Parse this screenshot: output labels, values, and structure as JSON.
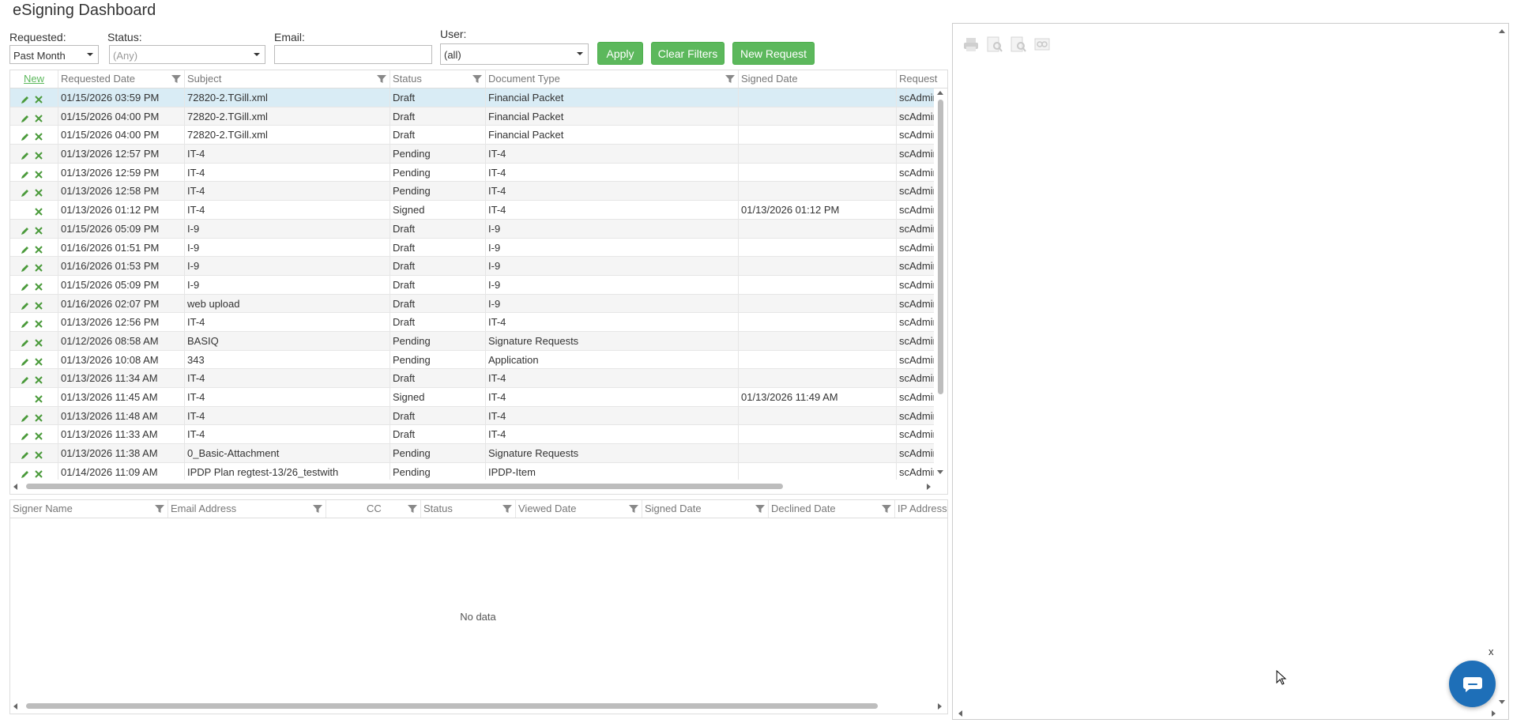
{
  "page": {
    "title": "eSigning Dashboard"
  },
  "filters": {
    "requested_label": "Requested:",
    "requested_value": "Past Month",
    "status_label": "Status:",
    "status_placeholder": "(Any)",
    "email_label": "Email:",
    "email_value": "",
    "user_label": "User:",
    "user_value": "(all)",
    "apply_label": "Apply",
    "clear_label": "Clear Filters",
    "new_request_label": "New Request"
  },
  "requests_grid": {
    "columns": {
      "new": "New",
      "requested_date": "Requested Date",
      "subject": "Subject",
      "status": "Status",
      "document_type": "Document Type",
      "signed_date": "Signed Date",
      "requested_by": "Request"
    },
    "rows": [
      {
        "edit": true,
        "requested": "01/15/2026 03:59 PM",
        "subject": "72820-2.TGill.xml",
        "status": "Draft",
        "doc_type": "Financial Packet",
        "signed": "",
        "by": "scAdmin"
      },
      {
        "edit": true,
        "requested": "01/15/2026 04:00 PM",
        "subject": "72820-2.TGill.xml",
        "status": "Draft",
        "doc_type": "Financial Packet",
        "signed": "",
        "by": "scAdmin"
      },
      {
        "edit": true,
        "requested": "01/15/2026 04:00 PM",
        "subject": "72820-2.TGill.xml",
        "status": "Draft",
        "doc_type": "Financial Packet",
        "signed": "",
        "by": "scAdmin"
      },
      {
        "edit": true,
        "requested": "01/13/2026 12:57 PM",
        "subject": "IT-4",
        "status": "Pending",
        "doc_type": "IT-4",
        "signed": "",
        "by": "scAdmin"
      },
      {
        "edit": true,
        "requested": "01/13/2026 12:59 PM",
        "subject": "IT-4",
        "status": "Pending",
        "doc_type": "IT-4",
        "signed": "",
        "by": "scAdmin"
      },
      {
        "edit": true,
        "requested": "01/13/2026 12:58 PM",
        "subject": "IT-4",
        "status": "Pending",
        "doc_type": "IT-4",
        "signed": "",
        "by": "scAdmin"
      },
      {
        "edit": false,
        "requested": "01/13/2026 01:12 PM",
        "subject": "IT-4",
        "status": "Signed",
        "doc_type": "IT-4",
        "signed": "01/13/2026 01:12 PM",
        "by": "scAdmin"
      },
      {
        "edit": true,
        "requested": "01/15/2026 05:09 PM",
        "subject": "I-9",
        "status": "Draft",
        "doc_type": "I-9",
        "signed": "",
        "by": "scAdmin"
      },
      {
        "edit": true,
        "requested": "01/16/2026 01:51 PM",
        "subject": "I-9",
        "status": "Draft",
        "doc_type": "I-9",
        "signed": "",
        "by": "scAdmin"
      },
      {
        "edit": true,
        "requested": "01/16/2026 01:53 PM",
        "subject": "I-9",
        "status": "Draft",
        "doc_type": "I-9",
        "signed": "",
        "by": "scAdmin"
      },
      {
        "edit": true,
        "requested": "01/15/2026 05:09 PM",
        "subject": "I-9",
        "status": "Draft",
        "doc_type": "I-9",
        "signed": "",
        "by": "scAdmin"
      },
      {
        "edit": true,
        "requested": "01/16/2026 02:07 PM",
        "subject": "web upload",
        "status": "Draft",
        "doc_type": "I-9",
        "signed": "",
        "by": "scAdmin"
      },
      {
        "edit": true,
        "requested": "01/13/2026 12:56 PM",
        "subject": "IT-4",
        "status": "Draft",
        "doc_type": "IT-4",
        "signed": "",
        "by": "scAdmin"
      },
      {
        "edit": true,
        "requested": "01/12/2026 08:58 AM",
        "subject": "BASIQ",
        "status": "Pending",
        "doc_type": "Signature Requests",
        "signed": "",
        "by": "scAdmin"
      },
      {
        "edit": true,
        "requested": "01/13/2026 10:08 AM",
        "subject": "343",
        "status": "Pending",
        "doc_type": "Application",
        "signed": "",
        "by": "scAdmin"
      },
      {
        "edit": true,
        "requested": "01/13/2026 11:34 AM",
        "subject": "IT-4",
        "status": "Draft",
        "doc_type": "IT-4",
        "signed": "",
        "by": "scAdmin"
      },
      {
        "edit": false,
        "requested": "01/13/2026 11:45 AM",
        "subject": "IT-4",
        "status": "Signed",
        "doc_type": "IT-4",
        "signed": "01/13/2026 11:49 AM",
        "by": "scAdmin"
      },
      {
        "edit": true,
        "requested": "01/13/2026 11:48 AM",
        "subject": "IT-4",
        "status": "Draft",
        "doc_type": "IT-4",
        "signed": "",
        "by": "scAdmin"
      },
      {
        "edit": true,
        "requested": "01/13/2026 11:33 AM",
        "subject": "IT-4",
        "status": "Draft",
        "doc_type": "IT-4",
        "signed": "",
        "by": "scAdmin"
      },
      {
        "edit": true,
        "requested": "01/13/2026 11:38 AM",
        "subject": "0_Basic-Attachment",
        "status": "Pending",
        "doc_type": "Signature Requests",
        "signed": "",
        "by": "scAdmin"
      },
      {
        "edit": true,
        "requested": "01/14/2026 11:09 AM",
        "subject": "IPDP Plan regtest-13/26_testwith",
        "status": "Pending",
        "doc_type": "IPDP-Item",
        "signed": "",
        "by": "scAdmin"
      }
    ]
  },
  "signers_grid": {
    "columns": {
      "signer_name": "Signer Name",
      "email_address": "Email Address",
      "cc": "CC",
      "status": "Status",
      "viewed_date": "Viewed Date",
      "signed_date": "Signed Date",
      "declined_date": "Declined Date",
      "ip_address": "IP Address"
    },
    "empty_text": "No data"
  },
  "viewer": {
    "tools": [
      "print-icon",
      "zoom-in-icon",
      "zoom-out-icon",
      "fit-icon"
    ]
  },
  "chat": {
    "close_label": "x"
  },
  "colors": {
    "accent": "#5cb85c",
    "selected_row": "#d9ecf5",
    "chat": "#1e6fb8"
  }
}
